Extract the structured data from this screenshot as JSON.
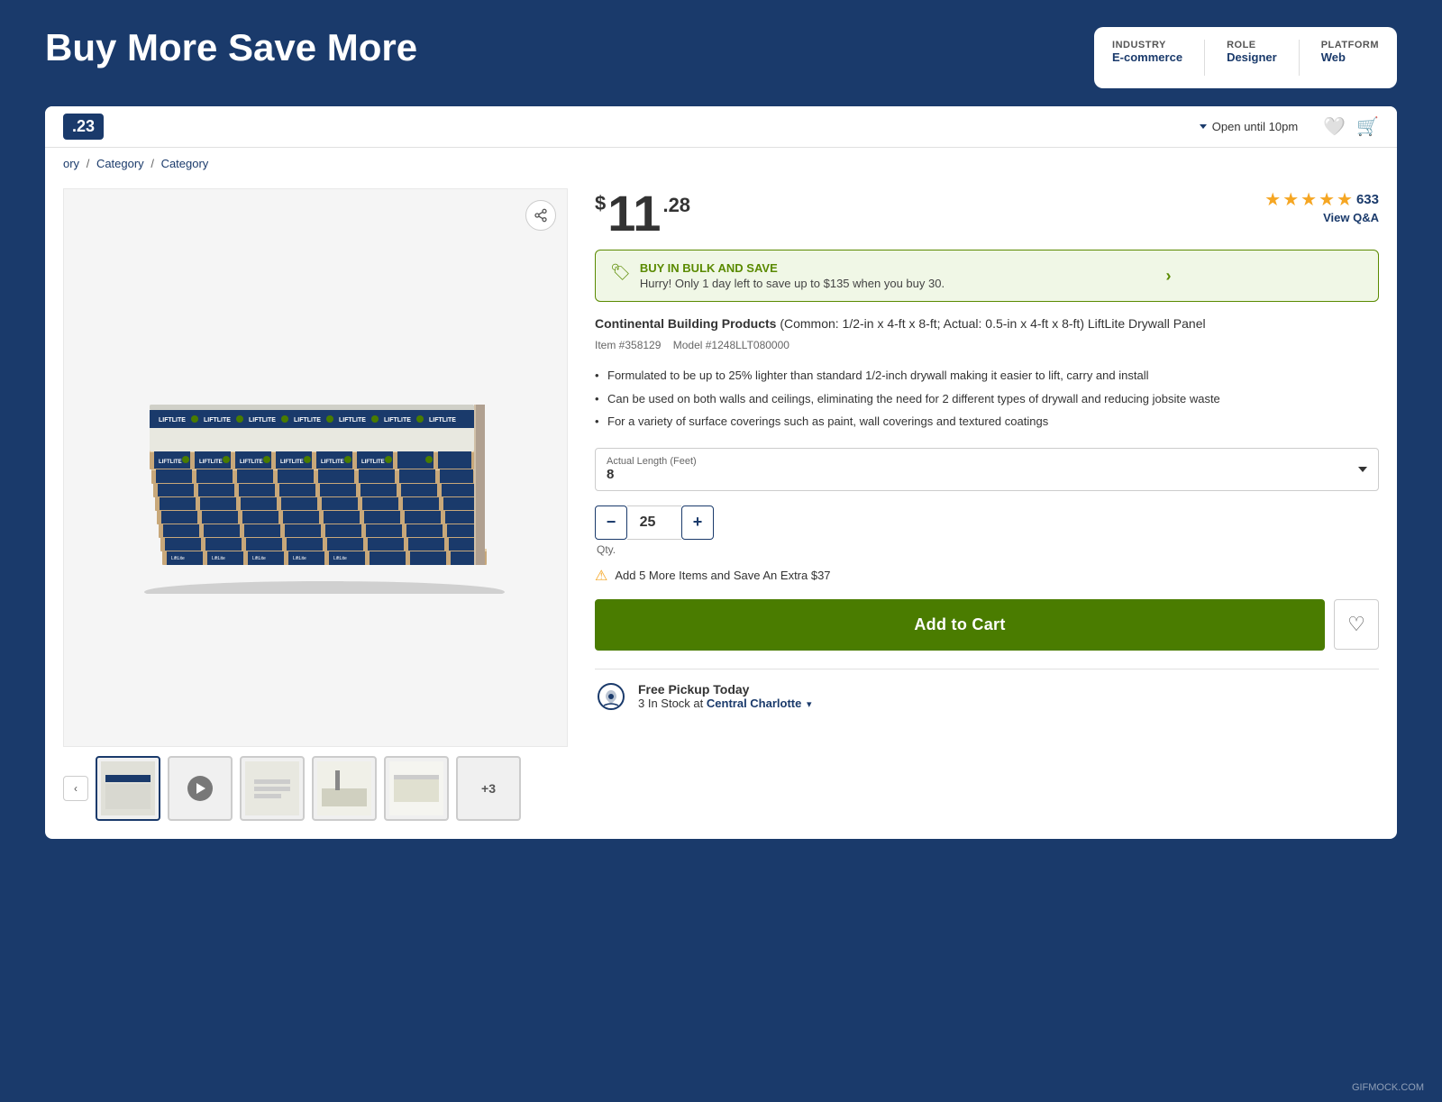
{
  "banner": {
    "title": "Buy More Save More",
    "tags": [
      {
        "label": "INDUSTRY",
        "value": "E-commerce"
      },
      {
        "label": "ROLE",
        "value": "Designer"
      },
      {
        "label": "PLATFORM",
        "value": "Web"
      }
    ]
  },
  "store_header": {
    "price_badge": ".23",
    "open_text": "Open until 10pm"
  },
  "breadcrumb": {
    "items": [
      "ory",
      "Category",
      "Category"
    ]
  },
  "product": {
    "price_dollar": "$",
    "price_main": "11",
    "price_cents": ".28",
    "rating": 4.5,
    "review_count": "633",
    "view_qa": "View Q&A",
    "bulk_save_title": "BUY IN BULK AND SAVE",
    "bulk_save_sub": "Hurry! Only 1 day left to save up to $135 when you buy 30.",
    "title_brand": "Continental Building Products",
    "title_rest": " (Common: 1/2-in x 4-ft x 8-ft; Actual: 0.5-in x 4-ft x 8-ft) LiftLite Drywall Panel",
    "item_number": "Item #358129",
    "model_number": "Model #1248LLT080000",
    "bullets": [
      "Formulated to be up to 25% lighter than standard 1/2-inch drywall making it easier to lift, carry and install",
      "Can be used on both walls and ceilings, eliminating the need for 2 different types of drywall and reducing jobsite waste",
      "For a variety of surface coverings such as paint, wall coverings and textured coatings"
    ],
    "dropdown_label": "Actual Length (Feet)",
    "dropdown_value": "8",
    "qty_value": "25",
    "qty_label": "Qty.",
    "save_alert": "Add 5 More Items and Save An Extra $37",
    "add_to_cart": "Add to Cart",
    "pickup_title": "Free Pickup Today",
    "pickup_sub": "3 In Stock at",
    "pickup_location": "Central Charlotte"
  },
  "thumbnails": [
    {
      "type": "image",
      "active": true
    },
    {
      "type": "video"
    },
    {
      "type": "image"
    },
    {
      "type": "image"
    },
    {
      "type": "image"
    },
    {
      "type": "more",
      "label": "+3"
    }
  ],
  "watermark": "GIFMOCK.COM"
}
